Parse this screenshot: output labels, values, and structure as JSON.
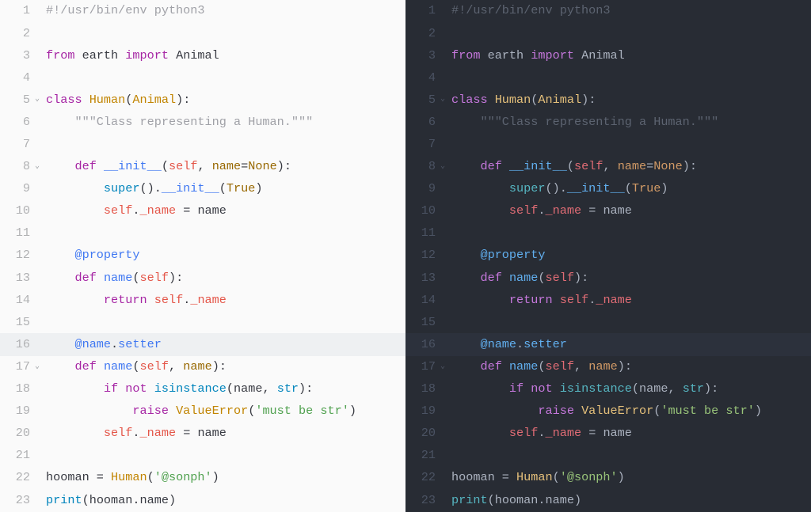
{
  "highlighted_line": 16,
  "fold_marker": "⌄",
  "foldable_lines": [
    5,
    8,
    17
  ],
  "panes": [
    {
      "id": "light",
      "theme": "light"
    },
    {
      "id": "dark",
      "theme": "dark"
    }
  ],
  "lines": [
    {
      "n": 1,
      "tokens": [
        {
          "t": "#!/usr/bin/env python3",
          "c": "comment"
        }
      ]
    },
    {
      "n": 2,
      "tokens": []
    },
    {
      "n": 3,
      "tokens": [
        {
          "t": "from ",
          "c": "keyword"
        },
        {
          "t": "earth ",
          "c": "default"
        },
        {
          "t": "import ",
          "c": "keyword"
        },
        {
          "t": "Animal",
          "c": "default"
        }
      ]
    },
    {
      "n": 4,
      "tokens": []
    },
    {
      "n": 5,
      "tokens": [
        {
          "t": "class ",
          "c": "keyword"
        },
        {
          "t": "Human",
          "c": "class"
        },
        {
          "t": "(",
          "c": "punct"
        },
        {
          "t": "Animal",
          "c": "class"
        },
        {
          "t": ")",
          "c": "punct"
        },
        {
          "t": ":",
          "c": "punct"
        }
      ]
    },
    {
      "n": 6,
      "tokens": [
        {
          "t": "    ",
          "c": "default"
        },
        {
          "t": "\"\"\"Class representing a Human.\"\"\"",
          "c": "comment"
        }
      ]
    },
    {
      "n": 7,
      "tokens": []
    },
    {
      "n": 8,
      "tokens": [
        {
          "t": "    ",
          "c": "default"
        },
        {
          "t": "def ",
          "c": "keyword"
        },
        {
          "t": "__init__",
          "c": "func"
        },
        {
          "t": "(",
          "c": "punct"
        },
        {
          "t": "self",
          "c": "self"
        },
        {
          "t": ", ",
          "c": "punct"
        },
        {
          "t": "name",
          "c": "param"
        },
        {
          "t": "=",
          "c": "op"
        },
        {
          "t": "None",
          "c": "const"
        },
        {
          "t": ")",
          "c": "punct"
        },
        {
          "t": ":",
          "c": "punct"
        }
      ]
    },
    {
      "n": 9,
      "tokens": [
        {
          "t": "        ",
          "c": "default"
        },
        {
          "t": "super",
          "c": "builtin"
        },
        {
          "t": "().",
          "c": "punct"
        },
        {
          "t": "__init__",
          "c": "func"
        },
        {
          "t": "(",
          "c": "punct"
        },
        {
          "t": "True",
          "c": "const"
        },
        {
          "t": ")",
          "c": "punct"
        }
      ]
    },
    {
      "n": 10,
      "tokens": [
        {
          "t": "        ",
          "c": "default"
        },
        {
          "t": "self",
          "c": "self"
        },
        {
          "t": ".",
          "c": "punct"
        },
        {
          "t": "_name",
          "c": "attr"
        },
        {
          "t": " = ",
          "c": "op"
        },
        {
          "t": "name",
          "c": "default"
        }
      ]
    },
    {
      "n": 11,
      "tokens": []
    },
    {
      "n": 12,
      "tokens": [
        {
          "t": "    ",
          "c": "default"
        },
        {
          "t": "@property",
          "c": "deco"
        }
      ]
    },
    {
      "n": 13,
      "tokens": [
        {
          "t": "    ",
          "c": "default"
        },
        {
          "t": "def ",
          "c": "keyword"
        },
        {
          "t": "name",
          "c": "func"
        },
        {
          "t": "(",
          "c": "punct"
        },
        {
          "t": "self",
          "c": "self"
        },
        {
          "t": ")",
          "c": "punct"
        },
        {
          "t": ":",
          "c": "punct"
        }
      ]
    },
    {
      "n": 14,
      "tokens": [
        {
          "t": "        ",
          "c": "default"
        },
        {
          "t": "return ",
          "c": "keyword"
        },
        {
          "t": "self",
          "c": "self"
        },
        {
          "t": ".",
          "c": "punct"
        },
        {
          "t": "_name",
          "c": "attr"
        }
      ]
    },
    {
      "n": 15,
      "tokens": []
    },
    {
      "n": 16,
      "tokens": [
        {
          "t": "    ",
          "c": "default"
        },
        {
          "t": "@name",
          "c": "deco"
        },
        {
          "t": ".",
          "c": "punct"
        },
        {
          "t": "setter",
          "c": "func"
        }
      ]
    },
    {
      "n": 17,
      "tokens": [
        {
          "t": "    ",
          "c": "default"
        },
        {
          "t": "def ",
          "c": "keyword"
        },
        {
          "t": "name",
          "c": "func"
        },
        {
          "t": "(",
          "c": "punct"
        },
        {
          "t": "self",
          "c": "self"
        },
        {
          "t": ", ",
          "c": "punct"
        },
        {
          "t": "name",
          "c": "param"
        },
        {
          "t": ")",
          "c": "punct"
        },
        {
          "t": ":",
          "c": "punct"
        }
      ]
    },
    {
      "n": 18,
      "tokens": [
        {
          "t": "        ",
          "c": "default"
        },
        {
          "t": "if ",
          "c": "keyword"
        },
        {
          "t": "not ",
          "c": "keyword"
        },
        {
          "t": "isinstance",
          "c": "builtin"
        },
        {
          "t": "(",
          "c": "punct"
        },
        {
          "t": "name",
          "c": "default"
        },
        {
          "t": ", ",
          "c": "punct"
        },
        {
          "t": "str",
          "c": "builtin"
        },
        {
          "t": ")",
          "c": "punct"
        },
        {
          "t": ":",
          "c": "punct"
        }
      ]
    },
    {
      "n": 19,
      "tokens": [
        {
          "t": "            ",
          "c": "default"
        },
        {
          "t": "raise ",
          "c": "keyword"
        },
        {
          "t": "ValueError",
          "c": "class"
        },
        {
          "t": "(",
          "c": "punct"
        },
        {
          "t": "'must be str'",
          "c": "string"
        },
        {
          "t": ")",
          "c": "punct"
        }
      ]
    },
    {
      "n": 20,
      "tokens": [
        {
          "t": "        ",
          "c": "default"
        },
        {
          "t": "self",
          "c": "self"
        },
        {
          "t": ".",
          "c": "punct"
        },
        {
          "t": "_name",
          "c": "attr"
        },
        {
          "t": " = ",
          "c": "op"
        },
        {
          "t": "name",
          "c": "default"
        }
      ]
    },
    {
      "n": 21,
      "tokens": []
    },
    {
      "n": 22,
      "tokens": [
        {
          "t": "hooman",
          "c": "default"
        },
        {
          "t": " = ",
          "c": "op"
        },
        {
          "t": "Human",
          "c": "class"
        },
        {
          "t": "(",
          "c": "punct"
        },
        {
          "t": "'@sonph'",
          "c": "string"
        },
        {
          "t": ")",
          "c": "punct"
        }
      ]
    },
    {
      "n": 23,
      "tokens": [
        {
          "t": "print",
          "c": "builtin"
        },
        {
          "t": "(",
          "c": "punct"
        },
        {
          "t": "hooman",
          "c": "default"
        },
        {
          "t": ".",
          "c": "punct"
        },
        {
          "t": "name",
          "c": "default"
        },
        {
          "t": ")",
          "c": "punct"
        }
      ]
    }
  ]
}
